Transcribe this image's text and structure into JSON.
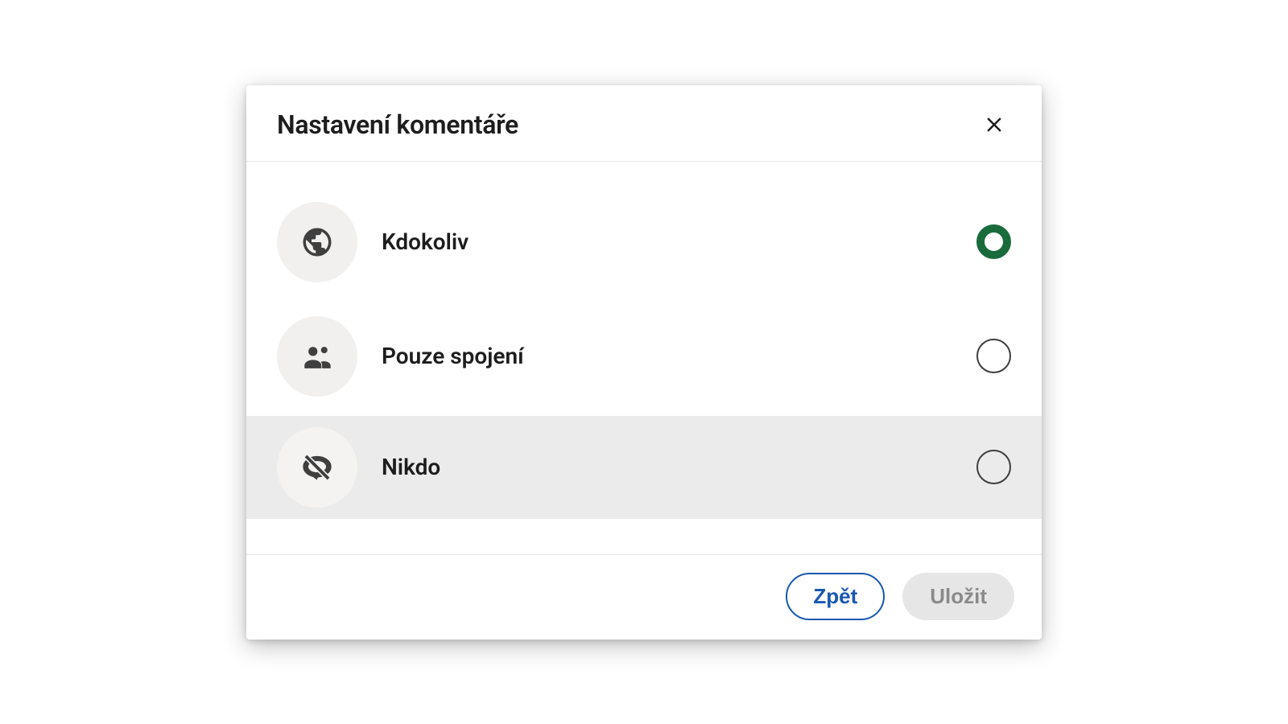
{
  "dialog": {
    "title": "Nastavení komentáře",
    "options": [
      {
        "label": "Kdokoliv",
        "selected": true,
        "highlighted": false,
        "icon": "globe"
      },
      {
        "label": "Pouze spojení",
        "selected": false,
        "highlighted": false,
        "icon": "people"
      },
      {
        "label": "Nikdo",
        "selected": false,
        "highlighted": true,
        "icon": "comment-off"
      }
    ],
    "footer": {
      "back_label": "Zpět",
      "save_label": "Uložit"
    }
  }
}
